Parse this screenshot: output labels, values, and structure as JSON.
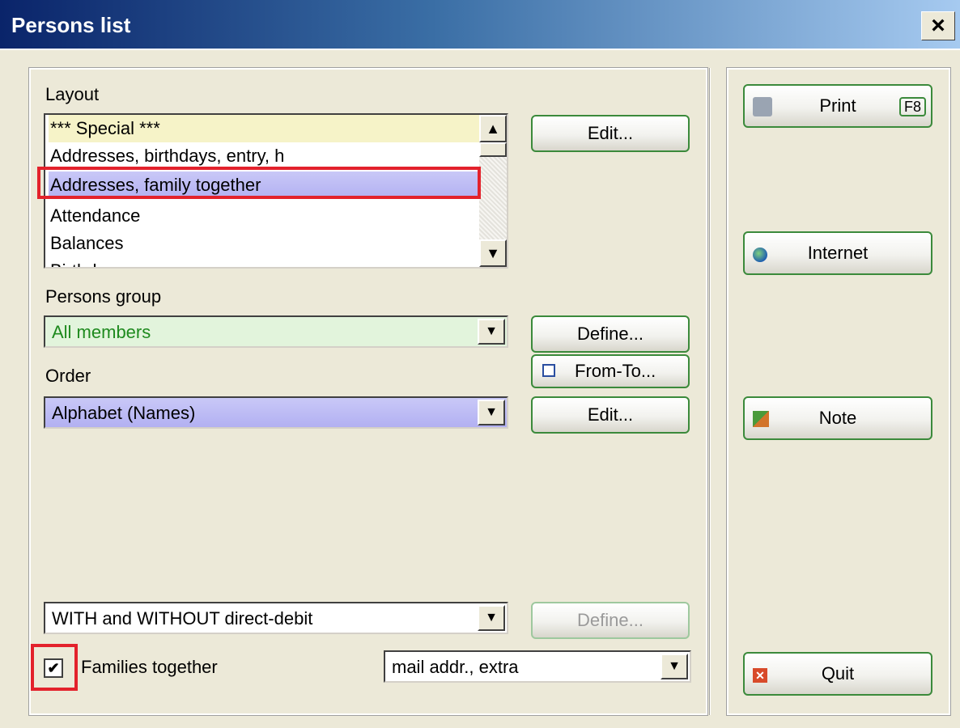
{
  "window": {
    "title": "Persons list",
    "close_label": "×"
  },
  "layout": {
    "label": "Layout",
    "items": [
      "*** Special ***",
      "Addresses, birthdays, entry, h",
      "Addresses, family together",
      "Attendance",
      "Balances",
      "Birthdays"
    ],
    "selected": "Addresses, family together",
    "edit_label": "Edit..."
  },
  "persons_group": {
    "label": "Persons group",
    "value": "All members",
    "define_label": "Define...",
    "from_to_label": "From-To..."
  },
  "order": {
    "label": "Order",
    "value": "Alphabet (Names)",
    "edit_label": "Edit..."
  },
  "direct_debit": {
    "value": "WITH and WITHOUT direct-debit",
    "define_label": "Define..."
  },
  "families": {
    "label": "Families together",
    "checked": true,
    "mail_option": "mail addr., extra"
  },
  "actions": {
    "print_label": "Print",
    "print_key": "F8",
    "internet_label": "Internet",
    "note_label": "Note",
    "quit_label": "Quit"
  },
  "colors": {
    "accent": "#0a246a",
    "highlight": "#e3222c",
    "button_border": "#3b8a3b",
    "group_text": "#1e8a1e"
  }
}
